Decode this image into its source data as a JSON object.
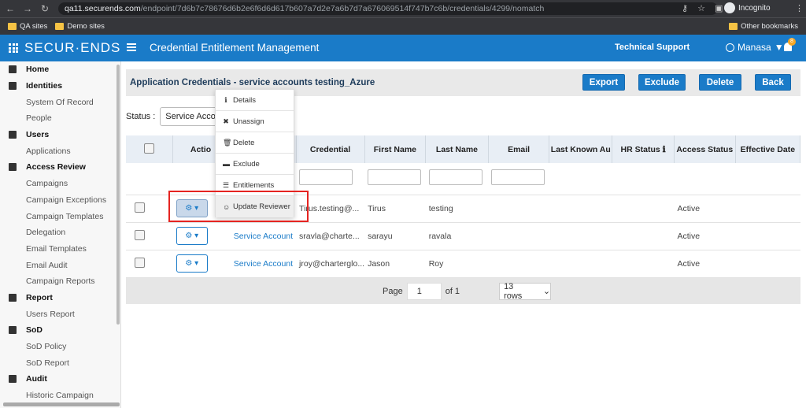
{
  "browser": {
    "url_host": "qa11.securends.com",
    "url_path": "/endpoint/7d6b7c78676d6b2e6f6d6d617b607a7d2e7a6b7d7a676069514f747b7c6b/credentials/4299/nomatch",
    "incognito_label": "Incognito",
    "bookmarks": [
      "QA sites",
      "Demo sites"
    ],
    "other_bookmarks": "Other bookmarks"
  },
  "app": {
    "logo": "SECUR·ENDS",
    "title": "Credential Entitlement Management",
    "support": "Technical Support",
    "user": "Manasa",
    "notifications": "8"
  },
  "sidebar": [
    {
      "label": "Home",
      "type": "head",
      "icon": "home-icon"
    },
    {
      "label": "Identities",
      "type": "head",
      "icon": "users-icon"
    },
    {
      "label": "System Of Record",
      "type": "sub"
    },
    {
      "label": "People",
      "type": "sub"
    },
    {
      "label": "Users",
      "type": "head",
      "icon": "user-icon"
    },
    {
      "label": "Applications",
      "type": "sub"
    },
    {
      "label": "Access Review",
      "type": "head",
      "icon": "grid-icon"
    },
    {
      "label": "Campaigns",
      "type": "sub"
    },
    {
      "label": "Campaign Exceptions",
      "type": "sub"
    },
    {
      "label": "Campaign Templates",
      "type": "sub"
    },
    {
      "label": "Delegation",
      "type": "sub"
    },
    {
      "label": "Email Templates",
      "type": "sub"
    },
    {
      "label": "Email Audit",
      "type": "sub"
    },
    {
      "label": "Campaign Reports",
      "type": "sub"
    },
    {
      "label": "Report",
      "type": "head",
      "icon": "report-icon"
    },
    {
      "label": "Users Report",
      "type": "sub"
    },
    {
      "label": "SoD",
      "type": "head",
      "icon": "table-icon"
    },
    {
      "label": "SoD Policy",
      "type": "sub"
    },
    {
      "label": "SoD Report",
      "type": "sub"
    },
    {
      "label": "Audit",
      "type": "head",
      "icon": "shield-icon"
    },
    {
      "label": "Historic Campaign",
      "type": "sub"
    }
  ],
  "panel": {
    "title": "Application Credentials - service accounts testing_Azure",
    "buttons": {
      "export": "Export",
      "exclude": "Exclude",
      "delete": "Delete",
      "back": "Back"
    },
    "status_label": "Status :",
    "status_value": "Service Account"
  },
  "table": {
    "headers": [
      "",
      "Actio",
      "",
      "Credential",
      "First Name",
      "Last Name",
      "Email",
      "Last Known Au",
      "HR Status ℹ",
      "Access Status",
      "Effective Date"
    ],
    "rows": [
      {
        "type": "t",
        "credential": "Tirus.testing@...",
        "first": "Tirus",
        "last": "testing",
        "access": "Active"
      },
      {
        "type": "Service Account",
        "credential": "sravla@charte...",
        "first": "sarayu",
        "last": "ravala",
        "access": "Active"
      },
      {
        "type": "Service Account",
        "credential": "jroy@charterglo...",
        "first": "Jason",
        "last": "Roy",
        "access": "Active"
      }
    ]
  },
  "pager": {
    "page_label": "Page",
    "page": "1",
    "of": "of 1",
    "rows": "13 rows"
  },
  "menu": [
    "Details",
    "Unassign",
    "Delete",
    "Exclude",
    "Entitlements",
    "Update Reviewer"
  ],
  "colors": {
    "primary": "#1a7bc8",
    "highlight": "#e52421"
  }
}
